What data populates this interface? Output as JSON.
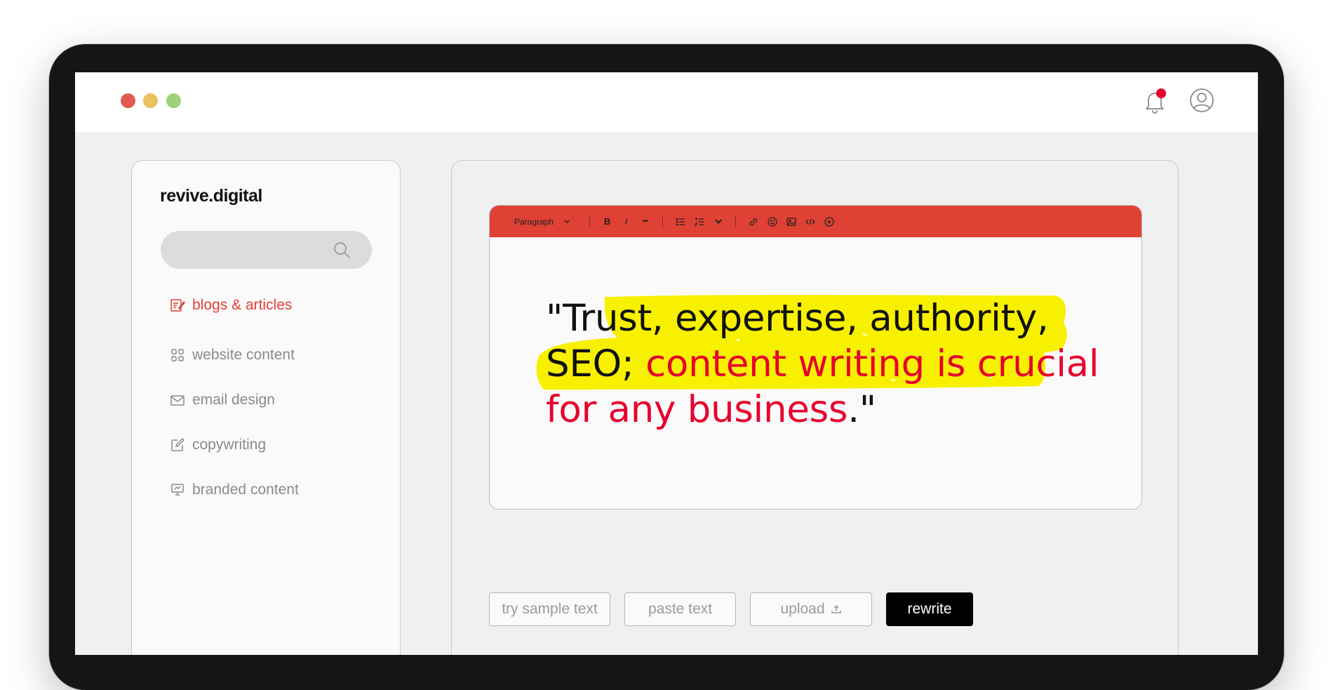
{
  "app": {
    "brand": "revive.digital"
  },
  "search": {
    "placeholder": ""
  },
  "sidebar": {
    "items": [
      {
        "label": "blogs & articles",
        "icon": "document-edit-icon",
        "active": true
      },
      {
        "label": "website content",
        "icon": "grid-icon",
        "active": false
      },
      {
        "label": "email design",
        "icon": "envelope-icon",
        "active": false
      },
      {
        "label": "copywriting",
        "icon": "pencil-square-icon",
        "active": false
      },
      {
        "label": "branded content",
        "icon": "monitor-icon",
        "active": false
      }
    ]
  },
  "editor": {
    "toolbar": {
      "paragraph_label": "Paragraph",
      "bold": "B",
      "italic": "I",
      "more": "•••"
    },
    "quote": {
      "black_part": "\"Trust, expertise, authority, SEO; ",
      "red_part": "content writing is crucial for any business",
      "end_part": ".\""
    }
  },
  "actions": {
    "try_label": "try sample text",
    "paste_label": "paste text",
    "upload_label": "upload",
    "rewrite_label": "rewrite"
  },
  "colors": {
    "accent": "#df4134",
    "highlight": "#f7f100",
    "quote_red": "#e6002e",
    "notification_badge": "#e6002e"
  }
}
